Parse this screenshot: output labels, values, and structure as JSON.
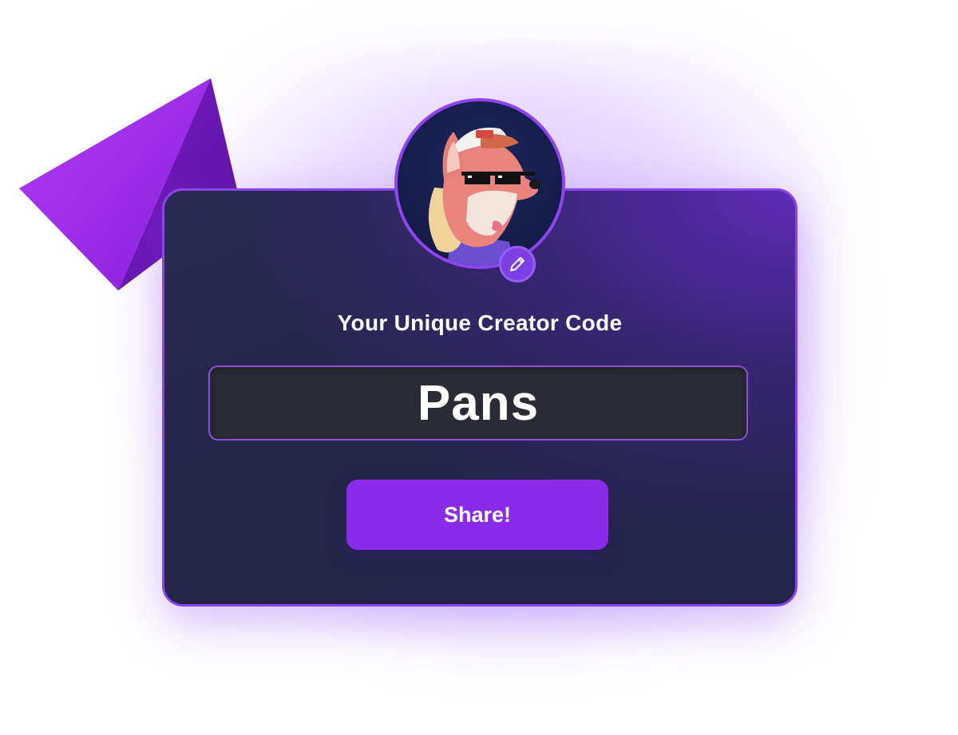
{
  "card": {
    "heading": "Your Unique Creator Code",
    "creator_code": "Pans",
    "share_label": "Share!"
  },
  "avatar": {
    "description_icon": "fox-avatar",
    "edit_icon": "pencil-icon"
  },
  "decoration": {
    "shape": "purple-pyramid"
  },
  "colors": {
    "accent": "#8a2be8",
    "card_border": "#8b45f0",
    "card_bg": "#232546",
    "code_bg": "#2b2b35"
  }
}
